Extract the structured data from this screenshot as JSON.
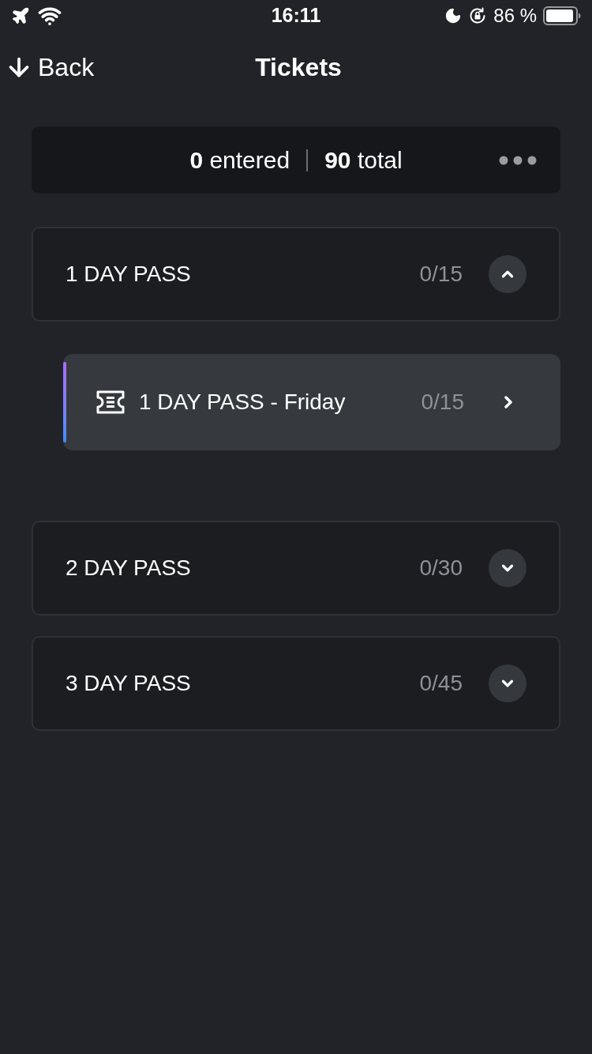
{
  "status_bar": {
    "time": "16:11",
    "battery": "86 %"
  },
  "nav": {
    "back": "Back",
    "title": "Tickets"
  },
  "summary": {
    "entered": "**0** entered",
    "total": "**90** total"
  },
  "groups": [
    {
      "name": "1 DAY PASS",
      "count": "0/15",
      "expanded": true,
      "tickets": [
        {
          "name": "1 DAY PASS - Friday",
          "count": "0/15"
        }
      ]
    },
    {
      "name": "2 DAY PASS",
      "count": "0/30",
      "expanded": false
    },
    {
      "name": "3 DAY PASS",
      "count": "0/45",
      "expanded": false
    }
  ]
}
